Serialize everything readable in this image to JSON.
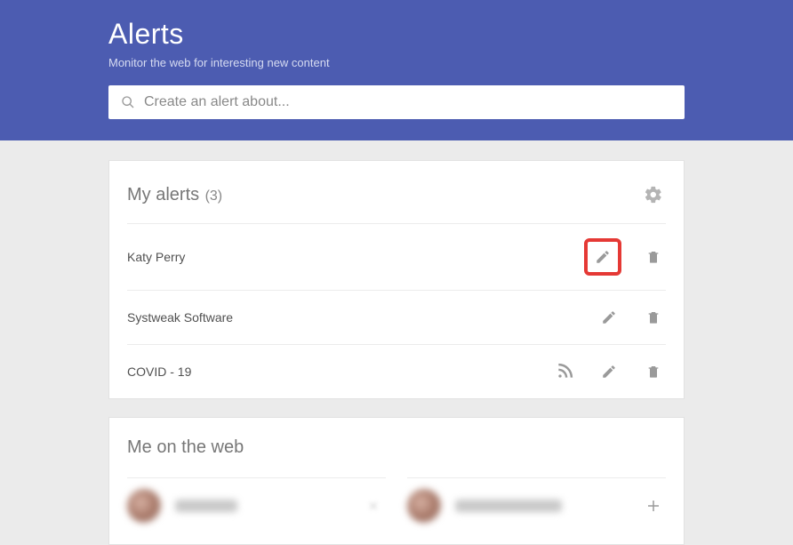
{
  "header": {
    "title": "Alerts",
    "subtitle": "Monitor the web for interesting new content",
    "search_placeholder": "Create an alert about..."
  },
  "my_alerts": {
    "title": "My alerts",
    "count": "(3)",
    "items": [
      {
        "name": "Katy Perry",
        "has_rss": false,
        "highlighted": true
      },
      {
        "name": "Systweak Software",
        "has_rss": false,
        "highlighted": false
      },
      {
        "name": "COVID - 19",
        "has_rss": true,
        "highlighted": false
      }
    ]
  },
  "me_on_web": {
    "title": "Me on the web"
  }
}
